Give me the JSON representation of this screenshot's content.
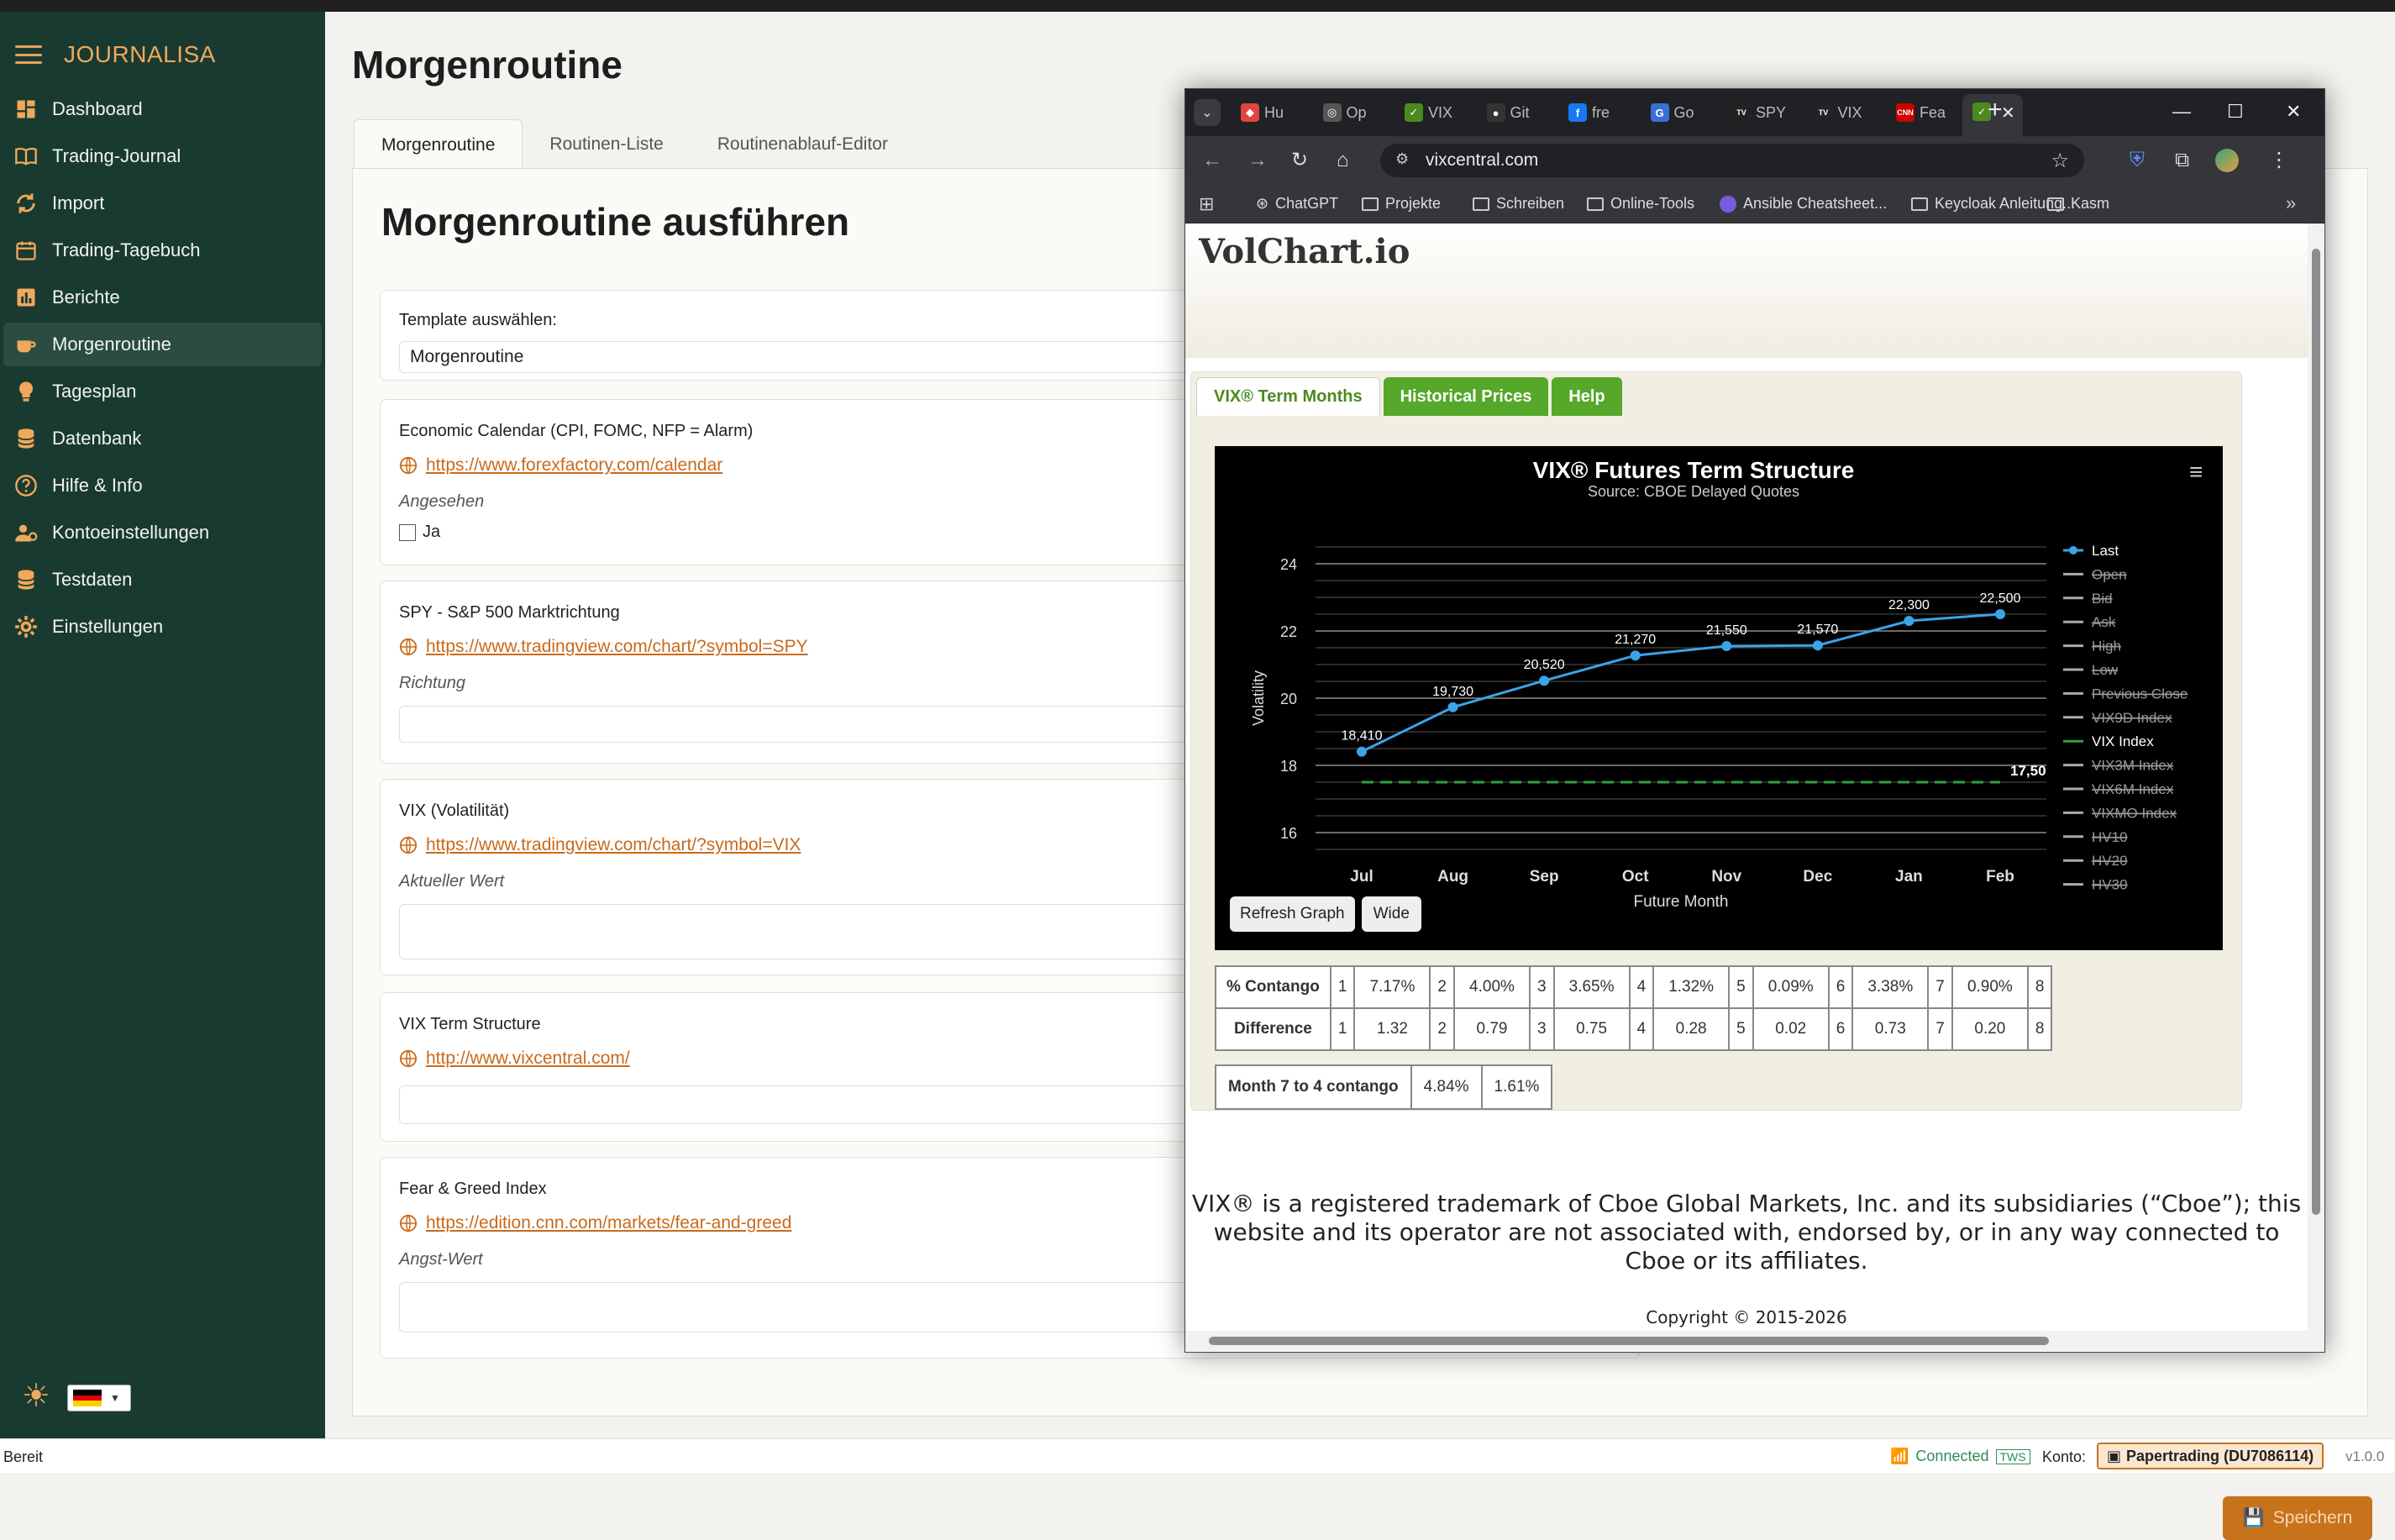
{
  "sidebar": {
    "brand": "JOURNALISA",
    "items": [
      {
        "label": "Dashboard",
        "icon": "dashboard-icon"
      },
      {
        "label": "Trading-Journal",
        "icon": "book-icon"
      },
      {
        "label": "Import",
        "icon": "sync-icon"
      },
      {
        "label": "Trading-Tagebuch",
        "icon": "calendar-icon"
      },
      {
        "label": "Berichte",
        "icon": "bar-chart-icon"
      },
      {
        "label": "Morgenroutine",
        "icon": "coffee-icon",
        "active": true
      },
      {
        "label": "Tagesplan",
        "icon": "lightbulb-icon"
      },
      {
        "label": "Datenbank",
        "icon": "database-icon"
      },
      {
        "label": "Hilfe & Info",
        "icon": "help-icon"
      },
      {
        "label": "Kontoeinstellungen",
        "icon": "user-gear-icon"
      },
      {
        "label": "Testdaten",
        "icon": "database-icon"
      },
      {
        "label": "Einstellungen",
        "icon": "gear-icon"
      }
    ]
  },
  "main": {
    "title": "Morgenroutine",
    "tabs": [
      "Morgenroutine",
      "Routinen-Liste",
      "Routinenablauf-Editor"
    ],
    "panel_title": "Morgenroutine ausführen",
    "template_label": "Template auswählen:",
    "template_value": "Morgenroutine",
    "cards": [
      {
        "title": "Economic Calendar (CPI, FOMC, NFP = Alarm)",
        "link": "https://www.forexfactory.com/calendar",
        "sub": "Angesehen",
        "checkbox": "Ja"
      },
      {
        "title": "SPY - S&P 500 Marktrichtung",
        "link": "https://www.tradingview.com/chart/?symbol=SPY",
        "sub": "Richtung"
      },
      {
        "title": "VIX (Volatilität)",
        "link": "https://www.tradingview.com/chart/?symbol=VIX",
        "sub": "Aktueller Wert"
      },
      {
        "title": "VIX Term Structure",
        "link": "http://www.vixcentral.com/"
      },
      {
        "title": "Fear & Greed Index",
        "link": "https://edition.cnn.com/markets/fear-and-greed",
        "sub": "Angst-Wert"
      }
    ],
    "save_label": "Speichern"
  },
  "status": {
    "left": "Bereit",
    "connected": "Connected",
    "tws": "TWS",
    "konto_label": "Konto:",
    "account": "Papertrading (DU7086114)",
    "version": "v1.0.0"
  },
  "browser": {
    "tabs": [
      "Hu",
      "Op",
      "VIX",
      "Git",
      "fre",
      "Go",
      "SPY",
      "VIX",
      "Fea"
    ],
    "url": "vixcentral.com",
    "bookmarks": [
      "ChatGPT",
      "Projekte",
      "Schreiben",
      "Online-Tools",
      "Ansible Cheatsheet...",
      "Keycloak Anleitung...",
      "Kasm"
    ],
    "site_logo": "VolChart.io",
    "site_tabs": [
      "VIX® Term Months",
      "Historical Prices",
      "Help"
    ],
    "buttons": {
      "refresh": "Refresh Graph",
      "wide": "Wide"
    },
    "contango_row": {
      "label": "% Contango",
      "cells": [
        "1",
        "7.17%",
        "2",
        "4.00%",
        "3",
        "3.65%",
        "4",
        "1.32%",
        "5",
        "0.09%",
        "6",
        "3.38%",
        "7",
        "0.90%",
        "8"
      ]
    },
    "difference_row": {
      "label": "Difference",
      "cells": [
        "1",
        "1.32",
        "2",
        "0.79",
        "3",
        "0.75",
        "4",
        "0.28",
        "5",
        "0.02",
        "6",
        "0.73",
        "7",
        "0.20",
        "8"
      ]
    },
    "month_contango": {
      "label": "Month 7 to 4 contango",
      "v1": "4.84%",
      "v2": "1.61%"
    },
    "disclaimer": "VIX® is a registered trademark of Cboe Global Markets, Inc. and its subsidiaries (“Cboe”); this website and its operator are not associated with, endorsed by, or in any way connected to Cboe or its affiliates.",
    "copyright": "Copyright © 2015-2026"
  },
  "chart_data": {
    "type": "line",
    "title": "VIX® Futures Term Structure",
    "subtitle": "Source: CBOE Delayed Quotes",
    "xlabel": "Future Month",
    "ylabel": "Volatility",
    "categories": [
      "Jul",
      "Aug",
      "Sep",
      "Oct",
      "Nov",
      "Dec",
      "Jan",
      "Feb"
    ],
    "ylim": [
      15.5,
      24.5
    ],
    "yticks": [
      16,
      18,
      20,
      22,
      24
    ],
    "series": [
      {
        "name": "Last",
        "values": [
          18.41,
          19.73,
          20.52,
          21.27,
          21.55,
          21.57,
          22.3,
          22.5
        ],
        "labels": [
          "18,410",
          "19,730",
          "20,520",
          "21,270",
          "21,550",
          "21,570",
          "22,300",
          "22,500"
        ],
        "color": "#3ba3e8"
      },
      {
        "name": "VIX Index",
        "values": [
          17.5,
          17.5,
          17.5,
          17.5,
          17.5,
          17.5,
          17.5,
          17.5
        ],
        "end_label": "17,50",
        "color": "#2ea043"
      }
    ],
    "legend": [
      {
        "name": "Last",
        "hidden": false
      },
      {
        "name": "Open",
        "hidden": true
      },
      {
        "name": "Bid",
        "hidden": true
      },
      {
        "name": "Ask",
        "hidden": true
      },
      {
        "name": "High",
        "hidden": true
      },
      {
        "name": "Low",
        "hidden": true
      },
      {
        "name": "Previous Close",
        "hidden": true
      },
      {
        "name": "VIX9D Index",
        "hidden": true
      },
      {
        "name": "VIX Index",
        "hidden": false
      },
      {
        "name": "VIX3M Index",
        "hidden": true
      },
      {
        "name": "VIX6M Index",
        "hidden": true
      },
      {
        "name": "VIXMO Index",
        "hidden": true
      },
      {
        "name": "HV10",
        "hidden": true
      },
      {
        "name": "HV20",
        "hidden": true
      },
      {
        "name": "HV30",
        "hidden": true
      }
    ],
    "legend_position": "right",
    "grid": true
  }
}
